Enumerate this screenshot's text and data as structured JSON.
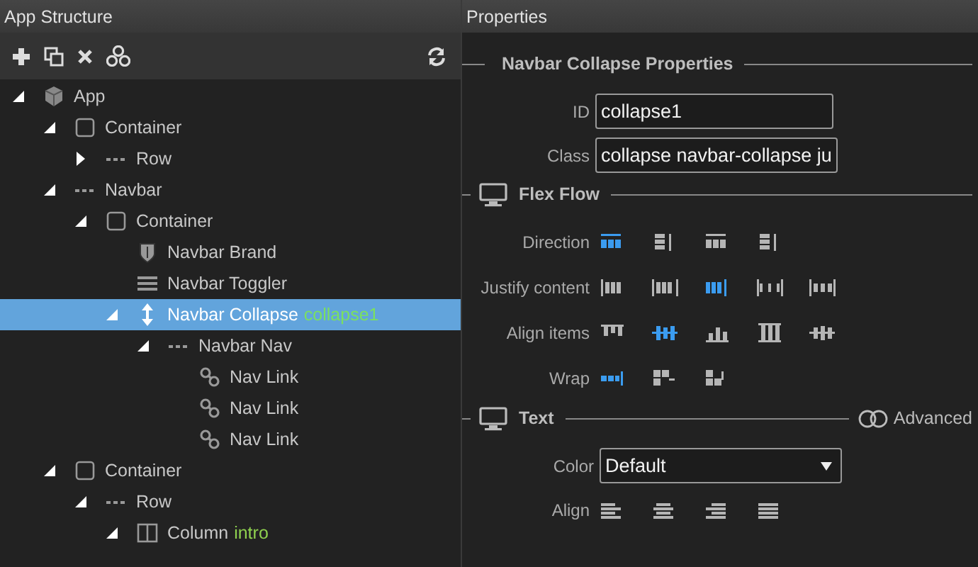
{
  "left_panel": {
    "title": "App Structure",
    "tree": [
      {
        "label": "App",
        "kind": "app",
        "expanded": true,
        "selected": false,
        "children": [
          {
            "label": "Container",
            "kind": "container",
            "expanded": true,
            "selected": false,
            "children": [
              {
                "label": "Row",
                "kind": "row",
                "expanded": false,
                "selected": false
              }
            ]
          },
          {
            "label": "Navbar",
            "kind": "row",
            "expanded": true,
            "selected": false,
            "children": [
              {
                "label": "Container",
                "kind": "container",
                "expanded": true,
                "selected": false,
                "children": [
                  {
                    "label": "Navbar Brand",
                    "kind": "brand",
                    "selected": false
                  },
                  {
                    "label": "Navbar Toggler",
                    "kind": "toggler",
                    "selected": false
                  },
                  {
                    "label": "Navbar Collapse",
                    "tag": "collapse1",
                    "kind": "collapse",
                    "expanded": true,
                    "selected": true,
                    "children": [
                      {
                        "label": "Navbar Nav",
                        "kind": "row",
                        "expanded": true,
                        "selected": false,
                        "children": [
                          {
                            "label": "Nav Link",
                            "kind": "link",
                            "selected": false
                          },
                          {
                            "label": "Nav Link",
                            "kind": "link",
                            "selected": false
                          },
                          {
                            "label": "Nav Link",
                            "kind": "link",
                            "selected": false
                          }
                        ]
                      }
                    ]
                  }
                ]
              }
            ]
          },
          {
            "label": "Container",
            "kind": "container",
            "expanded": true,
            "selected": false,
            "children": [
              {
                "label": "Row",
                "kind": "row",
                "expanded": true,
                "selected": false,
                "children": [
                  {
                    "label": "Column",
                    "tag": "intro",
                    "kind": "column",
                    "expanded": true,
                    "selected": false
                  }
                ]
              }
            ]
          }
        ]
      }
    ]
  },
  "right_panel": {
    "title": "Properties",
    "section_title": "Navbar Collapse Properties",
    "fields": [
      {
        "label": "ID",
        "value": "collapse1"
      },
      {
        "label": "Class",
        "value": "collapse navbar-collapse ju"
      }
    ],
    "sections": [
      {
        "title": "Flex Flow",
        "rows": [
          {
            "label": "Direction",
            "kind": "options",
            "options": [
              {
                "selected": true
              },
              {
                "selected": false
              },
              {
                "selected": false
              },
              {
                "selected": false
              }
            ]
          },
          {
            "label": "Justify content",
            "kind": "options",
            "options": [
              {
                "selected": false
              },
              {
                "selected": false
              },
              {
                "selected": true
              },
              {
                "selected": false
              },
              {
                "selected": false
              }
            ]
          },
          {
            "label": "Align items",
            "kind": "options",
            "options": [
              {
                "selected": false
              },
              {
                "selected": true
              },
              {
                "selected": false
              },
              {
                "selected": false
              },
              {
                "selected": false
              }
            ]
          },
          {
            "label": "Wrap",
            "kind": "options",
            "options": [
              {
                "selected": true
              },
              {
                "selected": false
              },
              {
                "selected": false
              }
            ]
          }
        ]
      },
      {
        "title": "Text",
        "advanced": {
          "label": "Advanced",
          "on": false
        },
        "rows": [
          {
            "label": "Color",
            "kind": "select",
            "value": "Default"
          },
          {
            "label": "Align",
            "kind": "options",
            "options": [
              {
                "selected": false
              },
              {
                "selected": false
              },
              {
                "selected": false
              },
              {
                "selected": false
              }
            ]
          }
        ]
      }
    ]
  }
}
